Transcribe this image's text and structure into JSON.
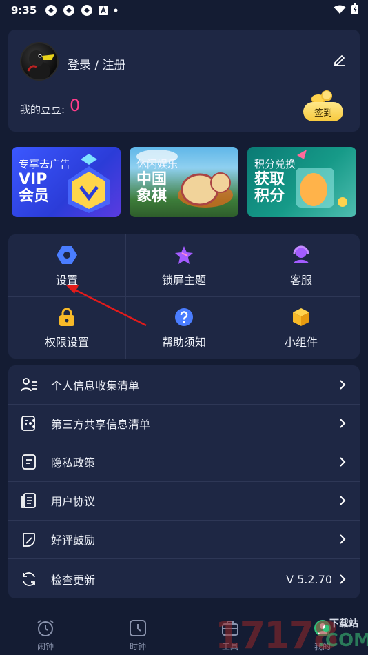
{
  "status_bar": {
    "time": "9:35"
  },
  "profile": {
    "login_text": "登录 / 注册",
    "beans_label": "我的豆豆:",
    "beans_value": "0",
    "signin_label": "签到"
  },
  "banners": [
    {
      "sub": "专享去广告",
      "main": "VIP\n会员"
    },
    {
      "sub": "休闲娱乐",
      "main": "中国\n象棋"
    },
    {
      "sub": "积分兑换",
      "main": "获取\n积分"
    }
  ],
  "grid": {
    "items": [
      {
        "label": "设置",
        "icon": "gear-icon"
      },
      {
        "label": "锁屏主题",
        "icon": "star-icon"
      },
      {
        "label": "客服",
        "icon": "headset-icon"
      },
      {
        "label": "权限设置",
        "icon": "lock-icon"
      },
      {
        "label": "帮助须知",
        "icon": "help-icon"
      },
      {
        "label": "小组件",
        "icon": "cube-icon"
      }
    ]
  },
  "list": {
    "items": [
      {
        "label": "个人信息收集清单",
        "value": ""
      },
      {
        "label": "第三方共享信息清单",
        "value": ""
      },
      {
        "label": "隐私政策",
        "value": ""
      },
      {
        "label": "用户协议",
        "value": ""
      },
      {
        "label": "好评鼓励",
        "value": ""
      },
      {
        "label": "检查更新",
        "value": "V 5.2.70"
      }
    ]
  },
  "bottom_nav": {
    "tabs": [
      {
        "label": "闹钟"
      },
      {
        "label": "时钟"
      },
      {
        "label": "工具"
      },
      {
        "label": "我的"
      }
    ]
  },
  "watermark": {
    "number": "17178",
    "site": "下载站",
    "domain": ".COM"
  },
  "colors": {
    "background": "#141c33",
    "card": "#1e2744",
    "accent_pink": "#ff3d8b",
    "icon_blue": "#4a7dff",
    "icon_purple": "#a35cff",
    "icon_yellow": "#f7b928"
  }
}
